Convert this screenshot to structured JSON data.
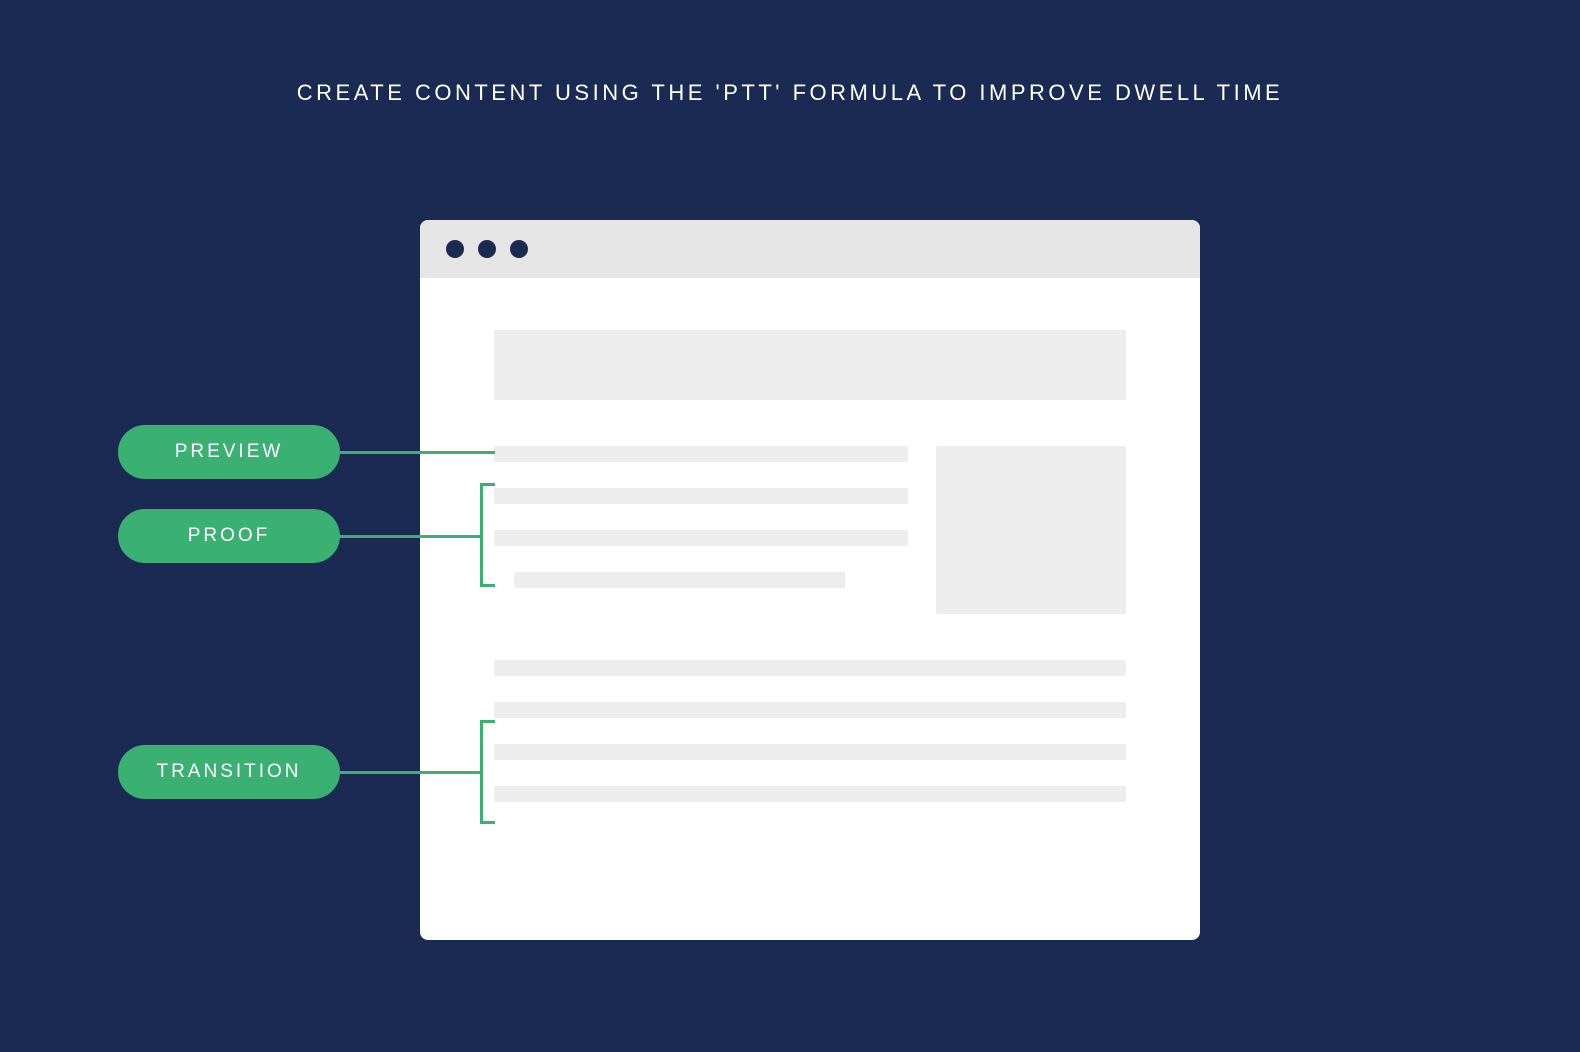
{
  "title": "CREATE CONTENT USING THE 'PTT' FORMULA TO IMPROVE DWELL TIME",
  "labels": {
    "preview": "PREVIEW",
    "proof": "PROOF",
    "transition": "TRANSITION"
  },
  "colors": {
    "background": "#1a2a52",
    "accent": "#3ab073",
    "browser_chrome": "#e5e5e5",
    "placeholder": "#ededed"
  }
}
